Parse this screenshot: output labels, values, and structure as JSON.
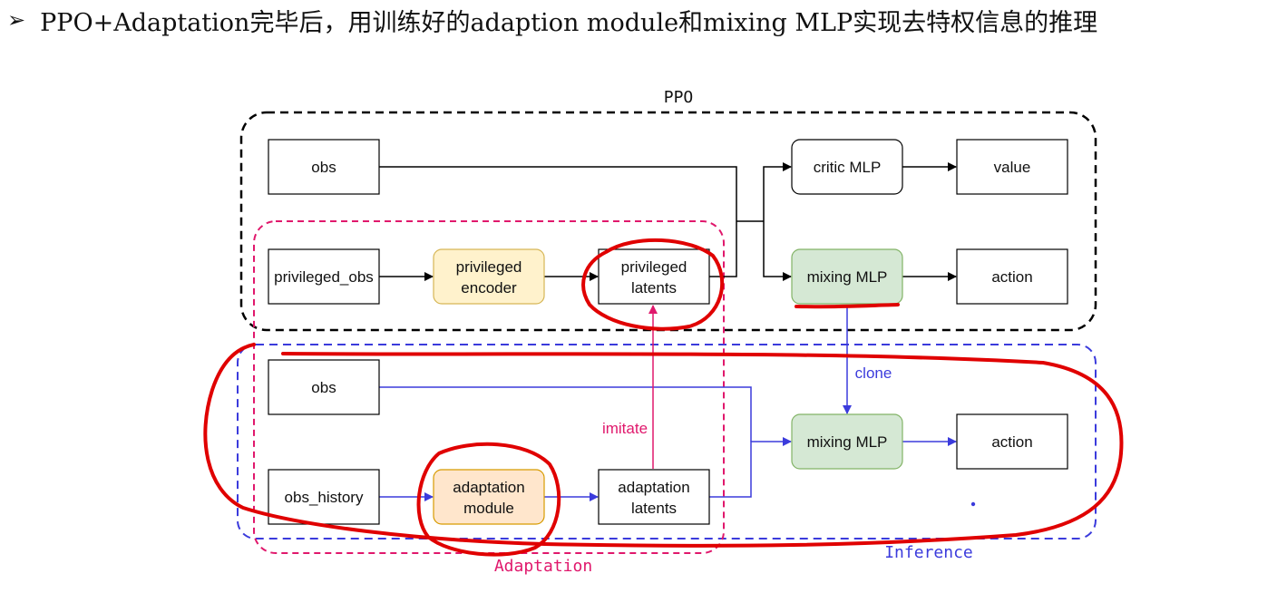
{
  "header": {
    "bullet": "➢",
    "text": "PPO+Adaptation完毕后，用训练好的adaption module和mixing MLP实现去特权信息的推理"
  },
  "groups": {
    "ppo": "PPO",
    "inference": "Inference",
    "adaptation": "Adaptation"
  },
  "nodes": {
    "obs_top": "obs",
    "privileged_obs": "privileged_obs",
    "privileged_encoder": [
      "privileged",
      "encoder"
    ],
    "privileged_latents": [
      "privileged",
      "latents"
    ],
    "critic_mlp": "critic MLP",
    "value": "value",
    "mixing_mlp_top": "mixing MLP",
    "action_top": "action",
    "obs_bottom": "obs",
    "obs_history": "obs_history",
    "adaptation_module": [
      "adaptation",
      "module"
    ],
    "adaptation_latents": [
      "adaptation",
      "latents"
    ],
    "mixing_mlp_bottom": "mixing MLP",
    "action_bottom": "action"
  },
  "edge_labels": {
    "clone": "clone",
    "imitate": "imitate"
  },
  "colors": {
    "ppo_border": "#000000",
    "inference_border": "#3b3bdc",
    "adaptation_border": "#e0186c",
    "encoder_fill": "#fff2cc",
    "encoder_border": "#d6b656",
    "adaptation_fill": "#ffe6cc",
    "adaptation_border_box": "#d79b00",
    "mixing_fill": "#d5e8d4",
    "mixing_border": "#82b366",
    "blue_edge": "#3b3bdc",
    "pink_edge": "#e0186c",
    "red_annotation": "#e00000"
  }
}
